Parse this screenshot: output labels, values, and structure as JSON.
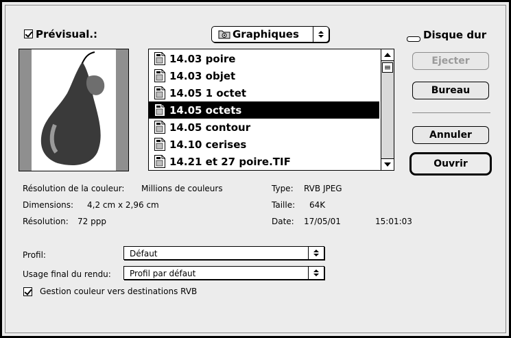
{
  "header": {
    "preview_label": "Prévisual.:",
    "preview_checked": true,
    "folder_popup": "Graphiques",
    "disk_label": "Disque dur"
  },
  "files": [
    {
      "name": "14.03 poire",
      "selected": false
    },
    {
      "name": "14.03 objet",
      "selected": false
    },
    {
      "name": "14.05 1 octet",
      "selected": false
    },
    {
      "name": "14.05 octets",
      "selected": true
    },
    {
      "name": "14.05 contour",
      "selected": false
    },
    {
      "name": "14.10 cerises",
      "selected": false
    },
    {
      "name": "14.21 et 27 poire.TIF",
      "selected": false
    }
  ],
  "buttons": {
    "eject": "Ejecter",
    "desktop": "Bureau",
    "cancel": "Annuler",
    "open": "Ouvrir"
  },
  "info": {
    "color_res_label": "Résolution de la couleur:",
    "color_res_value": "Millions de couleurs",
    "dims_label": "Dimensions:",
    "dims_value": "4,2  cm x 2,96  cm",
    "res_label": "Résolution:",
    "res_value": "72 ppp",
    "type_label": "Type:",
    "type_value": "RVB JPEG",
    "size_label": "Taille:",
    "size_value": "64K",
    "date_label": "Date:",
    "date_value": "17/05/01",
    "time_value": "15:01:03"
  },
  "options": {
    "profile_label": "Profil:",
    "profile_value": "Défaut",
    "intent_label": "Usage final du rendu:",
    "intent_value": "Profil par défaut",
    "color_mgmt_label": "Gestion couleur vers destinations RVB",
    "color_mgmt_checked": true
  }
}
